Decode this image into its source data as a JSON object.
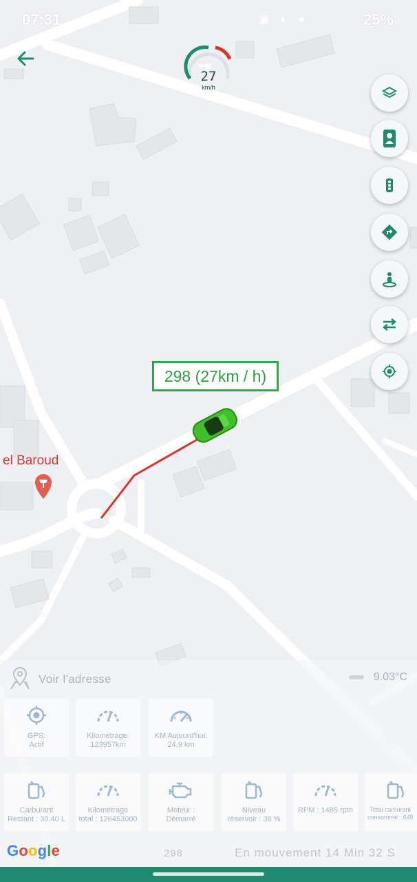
{
  "status_bar": {
    "time": "07:31",
    "battery": "25%"
  },
  "speedometer": {
    "speed": "27",
    "unit": "km/h",
    "fill_fraction": 0.45
  },
  "map": {
    "speed_label": "298 (27km / h)",
    "poi_label": "el Baroud"
  },
  "map_controls": [
    {
      "name": "layers-button",
      "icon": "layers-icon"
    },
    {
      "name": "driver-button",
      "icon": "driver-icon"
    },
    {
      "name": "traffic-button",
      "icon": "traffic-light-icon"
    },
    {
      "name": "directions-button",
      "icon": "directions-icon"
    },
    {
      "name": "street-view-button",
      "icon": "street-view-icon"
    },
    {
      "name": "swap-button",
      "icon": "swap-arrows-icon"
    },
    {
      "name": "locate-button",
      "icon": "crosshair-icon"
    }
  ],
  "address": {
    "label": "Voir l'adresse"
  },
  "weather": {
    "temperature": "9.03°C"
  },
  "info_cards_row1": [
    {
      "icon": "gps-icon",
      "label": "GPS:\nActif"
    },
    {
      "icon": "odometer-icon",
      "label": "Kilométrage:\n123957km"
    },
    {
      "icon": "gauge-icon",
      "label": "KM Aujourd'hui:\n24.9 km"
    }
  ],
  "info_cards_row2": [
    {
      "icon": "fuel-icon",
      "label": "Carburant\nRestant : 30.40 L"
    },
    {
      "icon": "odometer-icon",
      "label": "Kilométrage\ntotal : 126453000"
    },
    {
      "icon": "engine-icon",
      "label": "Moteur :\nDémarré"
    },
    {
      "icon": "fuel-icon",
      "label": "Niveau\nréservoir : 38 %"
    },
    {
      "icon": "gauge-icon",
      "label": "RPM : 1485 rpm"
    },
    {
      "icon": "fuel-icon",
      "label": "Total carburant\nconsommé : 649"
    }
  ],
  "footer": {
    "google": [
      "G",
      "o",
      "o",
      "g",
      "l",
      "e"
    ],
    "number": "298",
    "status": "En mouvement 14 Min 32 S"
  },
  "colors": {
    "accent": "#1f8a6e",
    "track": "#d9342b",
    "car": "#3fbf2a"
  }
}
